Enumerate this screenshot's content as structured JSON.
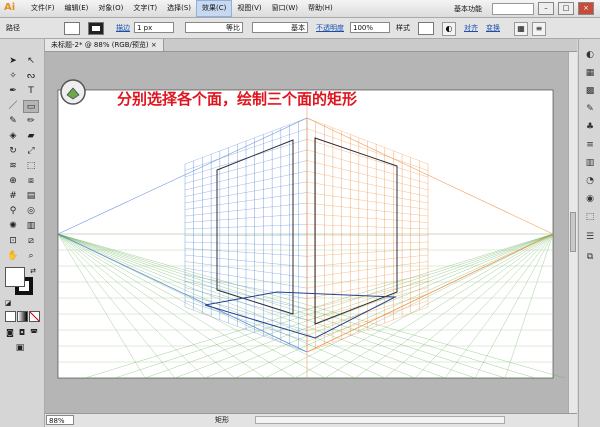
{
  "app": {
    "logo": "Ai",
    "workspace": "基本功能"
  },
  "menu": [
    "文件(F)",
    "编辑(E)",
    "对象(O)",
    "文字(T)",
    "选择(S)",
    "效果(C)",
    "视图(V)",
    "窗口(W)",
    "帮助(H)"
  ],
  "control": {
    "object_type": "路径",
    "stroke_label": "描边",
    "stroke_weight": "1 px",
    "profile_label": "等比",
    "brush_label": "基本",
    "opacity_label": "不透明度",
    "opacity_value": "100%",
    "style_label": "样式",
    "align_label": "对齐",
    "transform_label": "变换"
  },
  "document": {
    "tab_title": "未标题-2* @ 88% (RGB/预览)",
    "zoom": "88%",
    "status": "矩形",
    "annotation": "分别选择各个面，绘制三个面的矩形",
    "annotation_color": "#e0141e"
  },
  "colors": {
    "blue_grid": "#4f7fd6",
    "orange_grid": "#f08a3a",
    "green_grid": "#5aa84a"
  }
}
